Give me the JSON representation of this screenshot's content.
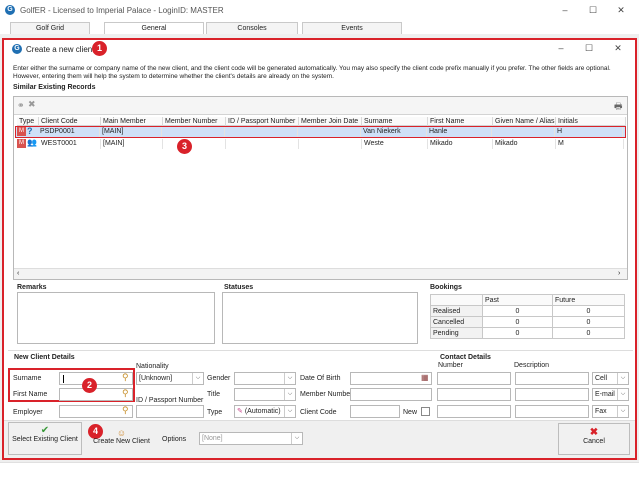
{
  "app": {
    "title": "GolfER - Licensed to Imperial Palace - LoginID: MASTER",
    "tabs": [
      "Golf Grid",
      "General",
      "Consoles",
      "Events"
    ]
  },
  "dialog": {
    "title": "Create a new client",
    "instructions": "Enter either the surname or company name of the new client, and the client code will be generated automatically. You may also specify the client code prefix manually if you prefer. The other fields are optional. However, entering them will help the system to determine whether the client's details are already on the system.",
    "similar_heading": "Similar Existing Records",
    "columns": [
      "Type",
      "Client Code",
      "Main Member",
      "Member Number",
      "ID / Passport Number",
      "Member Join Date",
      "Surname",
      "First Name",
      "Given Name / Alias",
      "Initials"
    ],
    "rows": [
      {
        "code": "PSDP0001",
        "main": "[MAIN]",
        "member_no": "",
        "id_no": "",
        "join": "",
        "surname": "Van Niekerk",
        "first": "Hanle",
        "given": "",
        "initials": "H"
      },
      {
        "code": "WEST0001",
        "main": "[MAIN]",
        "member_no": "",
        "id_no": "",
        "join": "",
        "surname": "Weste",
        "first": "Mikado",
        "given": "Mikado",
        "initials": "M"
      }
    ],
    "remarks_heading": "Remarks",
    "statuses_heading": "Statuses",
    "bookings": {
      "heading": "Bookings",
      "col_past": "Past",
      "col_future": "Future",
      "rows": [
        {
          "label": "Realised",
          "past": "0",
          "future": "0"
        },
        {
          "label": "Cancelled",
          "past": "0",
          "future": "0"
        },
        {
          "label": "Pending",
          "past": "0",
          "future": "0"
        }
      ]
    },
    "new_client": {
      "heading": "New Client Details",
      "surname_label": "Surname",
      "first_name_label": "First Name",
      "employer_label": "Employer",
      "nationality_label": "Nationality",
      "nationality_value": "[Unknown]",
      "id_label": "ID / Passport Number",
      "gender_label": "Gender",
      "title_label": "Title",
      "type_label": "Type",
      "type_value": "(Automatic)",
      "dob_label": "Date Of Birth",
      "member_number_label": "Member Number",
      "client_code_label": "Client Code",
      "new_label": "New"
    },
    "contact": {
      "heading": "Contact Details",
      "number_label": "Number",
      "description_label": "Description",
      "types": [
        "Cell",
        "E-mail",
        "Fax"
      ]
    },
    "buttons": {
      "select_existing": "Select Existing Client",
      "create_new": "Create New Client",
      "options_label": "Options",
      "options_value": "[None]",
      "cancel": "Cancel"
    },
    "badges": [
      "1",
      "2",
      "3",
      "4"
    ]
  },
  "colors": {
    "highlight": "#d9222a",
    "selected_row": "#cfe0f7",
    "accent": "#1f6fb2"
  }
}
